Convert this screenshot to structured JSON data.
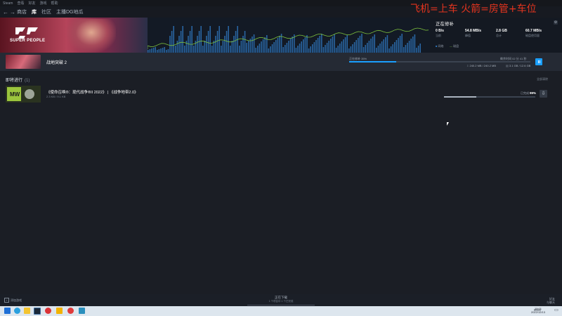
{
  "menubar": {
    "items": [
      "Steam",
      "查看",
      "好友",
      "游戏",
      "帮助"
    ]
  },
  "nav": {
    "back": "←",
    "forward": "→",
    "tabs": [
      "商店",
      "库",
      "社区",
      "主播DG地瓜"
    ]
  },
  "overlay": {
    "text": "飞机=上车 火箭=房管+车位"
  },
  "banner": {
    "game_name": "SUPER PEOPLE",
    "panel_title": "正在修补",
    "stats": [
      {
        "value": "0 B/s",
        "label": "当前"
      },
      {
        "value": "54.8 MB/s",
        "label": "峰值"
      },
      {
        "value": "2.8 GB",
        "label": "总计"
      },
      {
        "value": "60.7 MB/s",
        "label": "磁盘使用量"
      }
    ],
    "legend_network": "网络",
    "legend_disk": "磁盘",
    "colors": {
      "graph_bar": "#2f78c0",
      "graph_line": "#7ec23d",
      "accent": "#1a9fff"
    }
  },
  "current": {
    "name": "战地突破 2",
    "status": "正在修补 35%",
    "remaining": "剩余时间 02 分 41 秒",
    "progress": 0.26,
    "size_net": "240.2 MB / 240.2 MB",
    "size_disk": "3.1 GB / 12.6 GB"
  },
  "queue": {
    "title": "即将进行",
    "count": "(1)",
    "clear": "全部清除",
    "items": [
      {
        "name": "《使命召唤®：现代战争®II 2022》 | 《战争地带2.0》",
        "sub": "2.3 KB  /  9.1 KB",
        "percent_label": "已完成",
        "percent": "99%",
        "progress": 0.35
      }
    ]
  },
  "bottom": {
    "add_game": "添加游戏",
    "center_title": "正在下载",
    "center_sub": "1 个项目中 1 个已完成",
    "friends_line1": "好友",
    "friends_line2": "与聊天"
  },
  "taskbar": {
    "tray": "ENG",
    "time": "19:01",
    "date": "2022/12/13",
    "icons": [
      "windows-icon",
      "edge-icon",
      "explorer-icon",
      "steam-icon",
      "chrome-icon",
      "app-icon",
      "app-icon",
      "app-icon"
    ]
  }
}
